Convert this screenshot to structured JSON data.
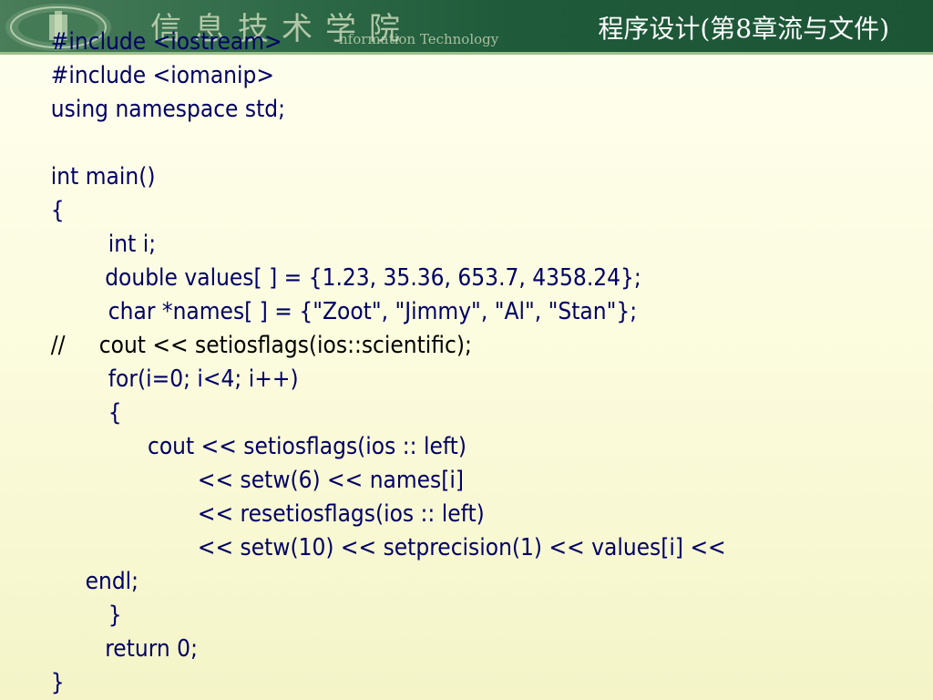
{
  "header": {
    "school_name": "信息技术学院",
    "school_subtitle": "nformation Technology",
    "slide_title": "程序设计(第8章流与文件)"
  },
  "code": {
    "line1": "#include <iostream>",
    "line2": "#include <iomanip>",
    "line3": "using namespace std;",
    "line4": "int main()",
    "line5": "{",
    "line6": "int i;",
    "line7": "double values[ ] = {1.23, 35.36, 653.7, 4358.24};",
    "line8": "char *names[ ] = {\"Zoot\", \"Jimmy\", \"Al\", \"Stan\"};",
    "line9": "//     cout << setiosflags(ios::scientific);",
    "line10": "for(i=0; i<4; i++)",
    "line11": "{",
    "line12": "cout << setiosflags(ios :: left)",
    "line13": "<< setw(6) << names[i]",
    "line14": "<< resetiosflags(ios :: left)",
    "line15": "<< setw(10) << setprecision(1) << values[i] <<",
    "line16": "endl;",
    "line17": "}",
    "line18": "return 0;",
    "line19": "}"
  },
  "colors": {
    "code_text": "#000066",
    "header_green": "#1f5a3a",
    "background": "#fbfbdc"
  }
}
